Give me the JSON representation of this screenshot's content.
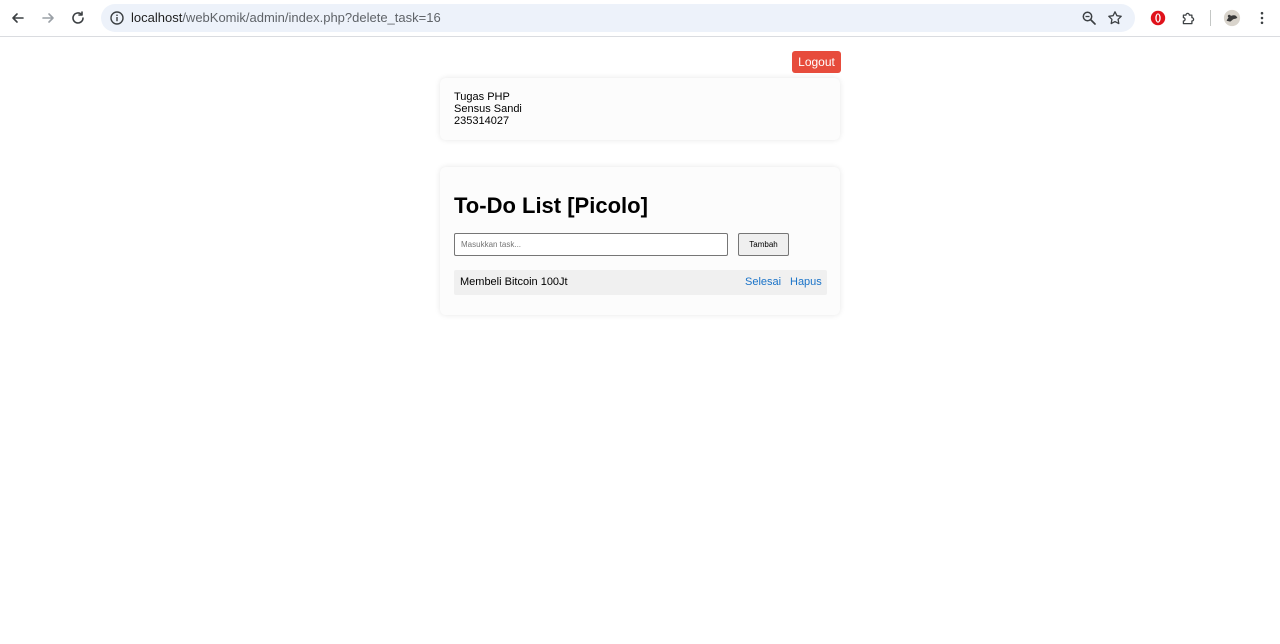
{
  "browser": {
    "url_host": "localhost",
    "url_path": "/webKomik/admin/index.php?delete_task=16",
    "icons": {
      "back": "back-arrow-icon",
      "forward": "forward-arrow-icon",
      "reload": "reload-icon",
      "site_info": "site-info-icon",
      "zoom": "zoom-icon",
      "bookmark": "bookmark-star-icon",
      "opera": "opera-extension-icon",
      "extensions": "puzzle-icon",
      "profile": "profile-avatar",
      "menu": "kebab-menu-icon"
    }
  },
  "header": {
    "logout_label": "Logout",
    "logout_color": "#e74c3c"
  },
  "info": {
    "line1": "Tugas PHP",
    "line2": "Sensus Sandi",
    "line3": "235314027"
  },
  "todo": {
    "title": "To-Do List [Picolo]",
    "input_placeholder": "Masukkan task...",
    "input_value": "",
    "add_label": "Tambah",
    "tasks": [
      {
        "text": "Membeli Bitcoin 100Jt",
        "done_label": "Selesai",
        "delete_label": "Hapus"
      }
    ],
    "link_color": "#1a73c8"
  }
}
